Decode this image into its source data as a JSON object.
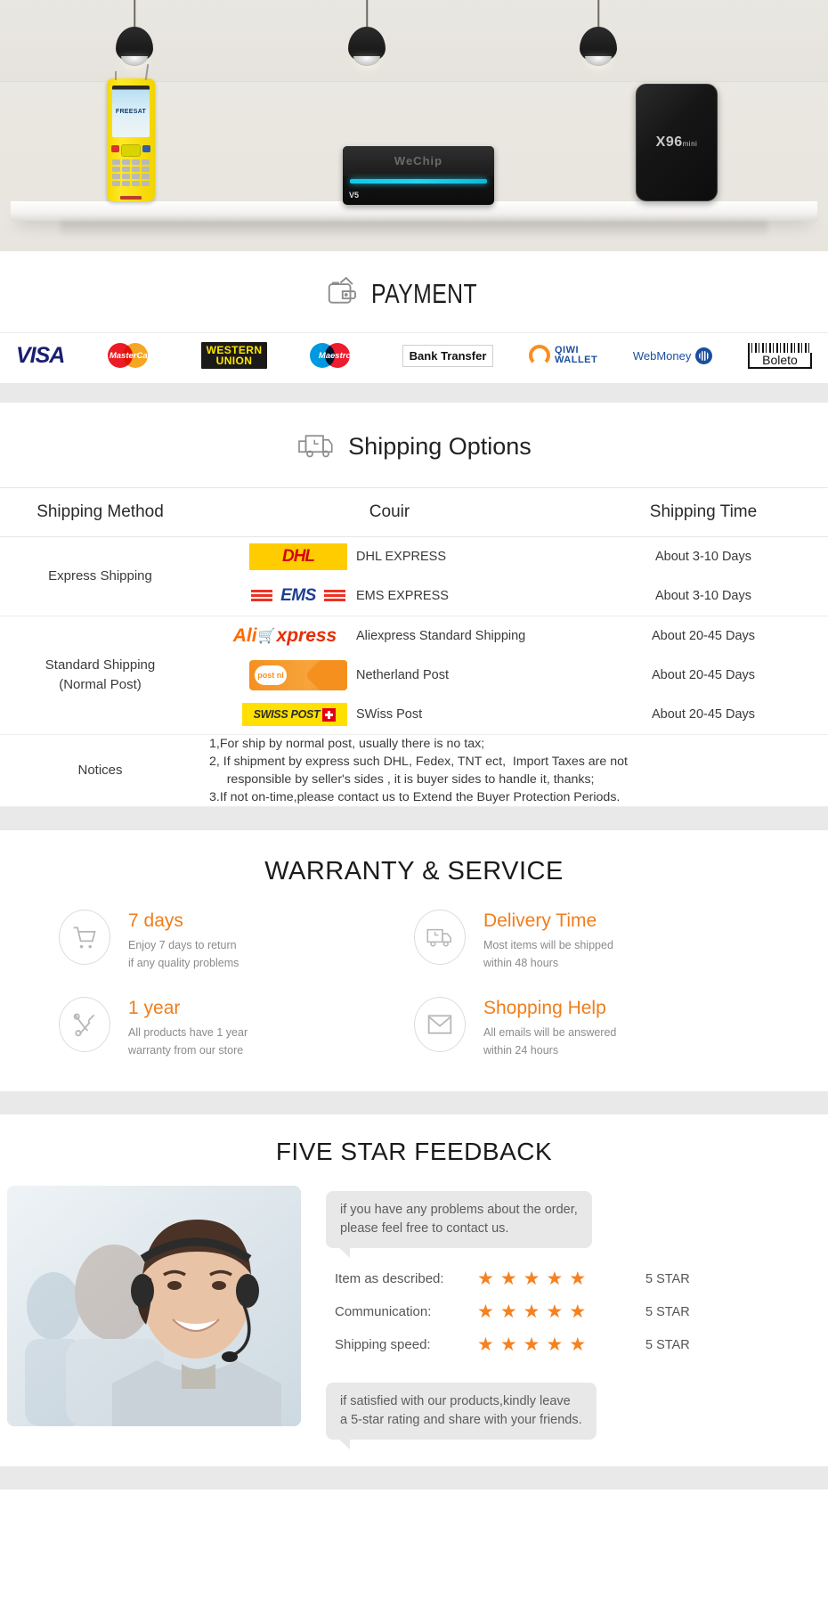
{
  "hero": {
    "products": [
      {
        "name": "satfinder",
        "brand": "FREESAT"
      },
      {
        "name": "tv-box",
        "brand": "WeChip",
        "model": "V5"
      },
      {
        "name": "android-box",
        "brand": "X",
        "model": "96",
        "suffix": "mini"
      }
    ]
  },
  "payment": {
    "title": "PAYMENT",
    "icon": "wallet-icon",
    "methods": [
      {
        "id": "visa",
        "label": "VISA"
      },
      {
        "id": "mastercard",
        "label": "MasterCard"
      },
      {
        "id": "western-union",
        "line1": "WESTERN",
        "line2": "UNION"
      },
      {
        "id": "maestro",
        "label": "Maestro"
      },
      {
        "id": "bank-transfer",
        "label": "Bank Transfer"
      },
      {
        "id": "qiwi-wallet",
        "line1": "QIWI",
        "line2": "WALLET"
      },
      {
        "id": "webmoney",
        "label": "WebMoney"
      },
      {
        "id": "boleto",
        "label": "Boleto"
      }
    ]
  },
  "shipping": {
    "title": "Shipping Options",
    "icon": "truck-clock-icon",
    "headers": {
      "method": "Shipping Method",
      "courier": "Couir",
      "time": "Shipping Time"
    },
    "groups": [
      {
        "method": "Express Shipping",
        "rows": [
          {
            "logo": "dhl",
            "logo_text": "DHL",
            "courier": "DHL EXPRESS",
            "time": "About 3-10 Days"
          },
          {
            "logo": "ems",
            "logo_text": "EMS",
            "courier": "EMS EXPRESS",
            "time": "About 3-10 Days"
          }
        ]
      },
      {
        "method": "Standard Shipping\n(Normal Post)",
        "method_line1": "Standard Shipping",
        "method_line2": "(Normal Post)",
        "rows": [
          {
            "logo": "aliexpress",
            "logo_text": "Aliexpress",
            "courier": "Aliexpress Standard Shipping",
            "time": "About 20-45 Days"
          },
          {
            "logo": "postnl",
            "logo_text": "post nl",
            "courier": "Netherland Post",
            "time": "About 20-45 Days"
          },
          {
            "logo": "swisspost",
            "logo_text": "SWISS POST",
            "courier": "SWiss Post",
            "time": "About 20-45 Days"
          }
        ]
      }
    ],
    "notices_label": "Notices",
    "notices": [
      "1,For ship by normal post, usually there is no tax;",
      "2, If shipment by express such DHL, Fedex, TNT ect,  Import Taxes are not",
      "     responsible by seller's sides , it is buyer sides to handle it, thanks;",
      "3.If not on-time,please contact us to Extend the Buyer Protection Periods."
    ]
  },
  "warranty": {
    "title": "WARRANTY & SERVICE",
    "accent_color": "#f07d1a",
    "items": [
      {
        "icon": "shopping-cart-icon",
        "heading": "7 days",
        "line1": "Enjoy 7 days to return",
        "line2": "if any quality problems"
      },
      {
        "icon": "delivery-truck-icon",
        "heading": "Delivery Time",
        "line1": "Most items will be shipped",
        "line2": "within 48 hours"
      },
      {
        "icon": "tools-icon",
        "heading": "1 year",
        "line1": "All products have 1 year",
        "line2": "warranty from our store"
      },
      {
        "icon": "envelope-icon",
        "heading": "Shopping Help",
        "line1": "All emails will be answered",
        "line2": "within 24 hours"
      }
    ]
  },
  "feedback": {
    "title": "FIVE STAR FEEDBACK",
    "photo_alt": "customer-service-agents-photo",
    "bubble_top_line1": "if you have any problems about the order,",
    "bubble_top_line2": "please feel free to contact us.",
    "star_color": "#f5821f",
    "ratings": [
      {
        "label": "Item as described:",
        "stars": 5,
        "value": "5 STAR"
      },
      {
        "label": "Communication:",
        "stars": 5,
        "value": "5 STAR"
      },
      {
        "label": "Shipping speed:",
        "stars": 5,
        "value": "5 STAR"
      }
    ],
    "bubble_bottom_line1": "if satisfied with our products,kindly leave",
    "bubble_bottom_line2": "a 5-star rating and share with your friends."
  }
}
